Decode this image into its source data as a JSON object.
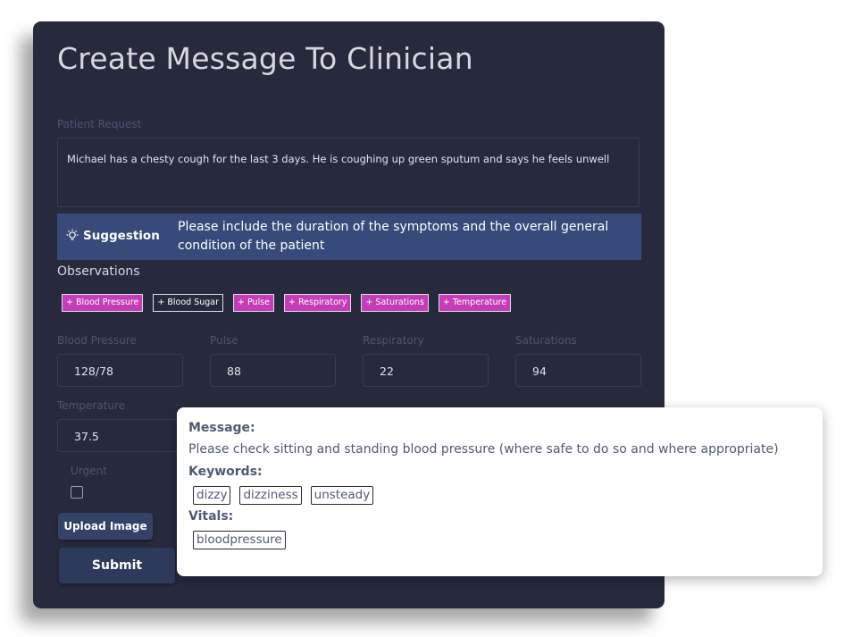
{
  "form": {
    "title": "Create Message To Clinician",
    "patient_request_label": "Patient Request",
    "patient_request_value": "Michael has a chesty cough for the last 3 days. He is coughing up green sputum and says he feels unwell",
    "suggestion": {
      "icon": "lightbulb-icon",
      "label": "Suggestion",
      "text": "Please include the duration of the symptoms and the overall general condition of the patient"
    },
    "observations_label": "Observations",
    "chips": [
      {
        "label": "+ Blood Pressure",
        "selected": true
      },
      {
        "label": "+ Blood Sugar",
        "selected": false
      },
      {
        "label": "+ Pulse",
        "selected": true
      },
      {
        "label": "+ Respiratory",
        "selected": true
      },
      {
        "label": "+ Saturations",
        "selected": true
      },
      {
        "label": "+ Temperature",
        "selected": true
      }
    ],
    "vitals": {
      "blood_pressure": {
        "label": "Blood Pressure",
        "value": "128/78"
      },
      "pulse": {
        "label": "Pulse",
        "value": "88"
      },
      "respiratory": {
        "label": "Respiratory",
        "value": "22"
      },
      "saturations": {
        "label": "Saturations",
        "value": "94"
      },
      "temperature": {
        "label": "Temperature",
        "value": "37.5"
      }
    },
    "urgent_label": "Urgent",
    "urgent_checked": false,
    "upload_label": "Upload Image",
    "submit_label": "Submit"
  },
  "popup": {
    "message_heading": "Message:",
    "message_text": "Please check sitting and standing blood pressure (where safe to do so and where appropriate)",
    "keywords_heading": "Keywords:",
    "keywords": [
      "dizzy",
      "dizziness",
      "unsteady"
    ],
    "vitals_heading": "Vitals:",
    "vitals": [
      "bloodpressure"
    ]
  },
  "colors": {
    "card_bg": "#272a3d",
    "suggestion_bg": "#374a7a",
    "chip_selected": "#c43cb8",
    "muted_label": "#4e5370",
    "popup_text": "#515a72"
  }
}
